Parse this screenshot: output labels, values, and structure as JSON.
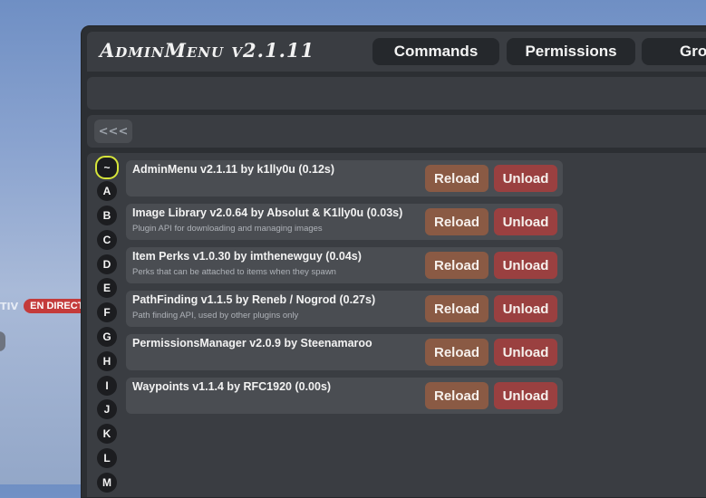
{
  "hud": {
    "prefix": "TIV",
    "live_badge": "EN DIRECT"
  },
  "header": {
    "title": "AdminMenu v2.1.11",
    "tabs": [
      "Commands",
      "Permissions",
      "Grou"
    ]
  },
  "back_label": "<<<",
  "letters": [
    "~",
    "A",
    "B",
    "C",
    "D",
    "E",
    "F",
    "G",
    "H",
    "I",
    "J",
    "K",
    "L",
    "M"
  ],
  "active_letter": "~",
  "plugins": [
    {
      "name": "AdminMenu v2.1.11 by k1lly0u  (0.12s)",
      "description": ""
    },
    {
      "name": "Image Library v2.0.64 by Absolut & K1lly0u  (0.03s)",
      "description": "Plugin API for downloading and managing images"
    },
    {
      "name": "Item Perks v1.0.30 by imthenewguy  (0.04s)",
      "description": "Perks that can be attached to items when they spawn"
    },
    {
      "name": "PathFinding v1.1.5 by Reneb / Nogrod  (0.27s)",
      "description": "Path finding API, used by other plugins only"
    },
    {
      "name": "PermissionsManager v2.0.9 by Steenamaroo",
      "description": ""
    },
    {
      "name": "Waypoints v1.1.4 by RFC1920  (0.00s)",
      "description": ""
    }
  ],
  "buttons": {
    "reload": "Reload",
    "unload": "Unload"
  },
  "colors": {
    "reload": "#8a5a44",
    "unload": "#9a4040",
    "active_letter_ring": "#d6e53a",
    "live_badge": "#c43b3b"
  }
}
